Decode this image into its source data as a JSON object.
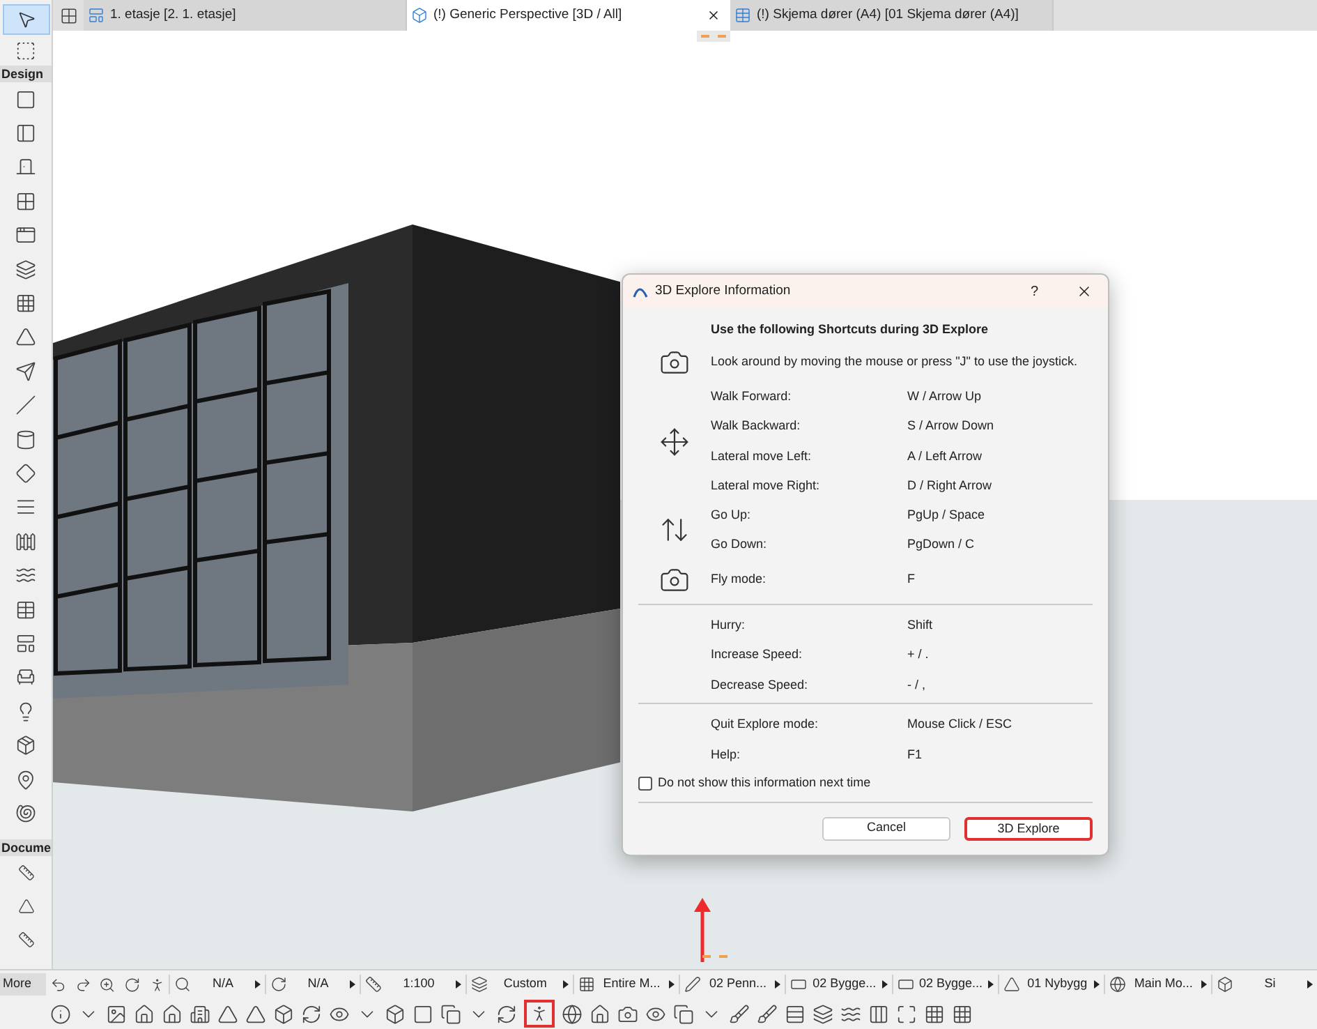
{
  "toolbox": {
    "arrow_tool": {
      "selected": true
    },
    "sections": [
      {
        "label": "Design"
      },
      {
        "label": "Docume"
      }
    ],
    "more_label": "More"
  },
  "tabs": [
    {
      "label": "1. etasje [2. 1. etasje]",
      "kind": "plan",
      "selected": false
    },
    {
      "label": "(!) Generic Perspective [3D / All]",
      "kind": "perspective",
      "selected": true
    },
    {
      "label": "(!) Skjema dører (A4) [01 Skjema dører (A4)]",
      "kind": "schedule",
      "selected": false
    }
  ],
  "dialog": {
    "title": "3D Explore Information",
    "help": "?",
    "heading": "Use the following Shortcuts during 3D Explore",
    "groups": [
      {
        "rows": [
          {
            "label": "Look around by moving the mouse or press \"J\" to use the joystick."
          }
        ]
      },
      {
        "rows": [
          {
            "label": "Walk Forward:",
            "shortcut": "W / Arrow Up"
          },
          {
            "label": "Walk Backward:",
            "shortcut": "S / Arrow Down"
          },
          {
            "label": "Lateral move Left:",
            "shortcut": "A / Left Arrow"
          },
          {
            "label": "Lateral move Right:",
            "shortcut": "D / Right Arrow"
          }
        ]
      },
      {
        "rows": [
          {
            "label": "Go Up:",
            "shortcut": "PgUp / Space"
          },
          {
            "label": "Go Down:",
            "shortcut": "PgDown / C"
          }
        ]
      },
      {
        "rows": [
          {
            "label": "Fly mode:",
            "shortcut": "F"
          }
        ]
      },
      {
        "rows": [
          {
            "label": "Hurry:",
            "shortcut": "Shift"
          },
          {
            "label": "Increase Speed:",
            "shortcut": "+ / ."
          },
          {
            "label": "Decrease Speed:",
            "shortcut": "- / ,"
          }
        ]
      },
      {
        "rows": [
          {
            "label": "Quit Explore mode:",
            "shortcut": "Mouse Click / ESC"
          },
          {
            "label": "Help:",
            "shortcut": "F1"
          }
        ]
      }
    ],
    "checkbox": {
      "label": "Do not show this information next time",
      "checked": false
    },
    "buttons": [
      {
        "label": "Cancel",
        "highlighted": false
      },
      {
        "label": "3D Explore",
        "highlighted": true
      }
    ]
  },
  "status_items": [
    {
      "text": "N/A"
    },
    {
      "text": "N/A"
    },
    {
      "text": "1:100"
    },
    {
      "text": "Custom"
    },
    {
      "text": "Entire M..."
    },
    {
      "text": "02 Penn..."
    },
    {
      "text": "02 Bygge..."
    },
    {
      "text": "02 Bygge..."
    },
    {
      "text": "01 Nybygg"
    },
    {
      "text": "Main Mo..."
    },
    {
      "text": "Si"
    }
  ],
  "explore_button": {
    "highlighted": true
  }
}
